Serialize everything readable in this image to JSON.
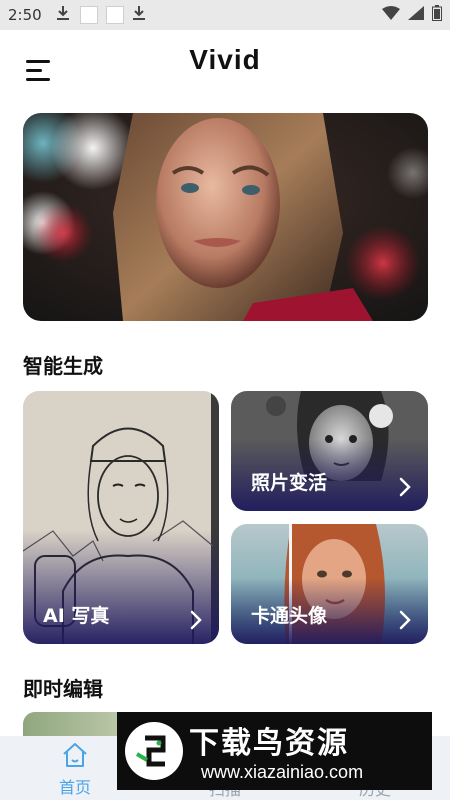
{
  "status_bar": {
    "time": "2:50"
  },
  "header": {
    "title": "Vivid"
  },
  "sections": {
    "smart_generation": "智能生成",
    "instant_edit": "即时编辑"
  },
  "cards": {
    "ai_portrait": "AI 写真",
    "photo_transform": "照片变活",
    "cartoon_avatar": "卡通头像"
  },
  "bottom_nav": {
    "home": "首页",
    "scan": "扫描",
    "history": "历史"
  },
  "watermark": {
    "title": "下载鸟资源",
    "url": "www.xiazainiao.com"
  },
  "colors": {
    "accent": "#4aa4ea",
    "nav_bg": "#eef2f6",
    "card_shadow": "#1f1a5e"
  }
}
